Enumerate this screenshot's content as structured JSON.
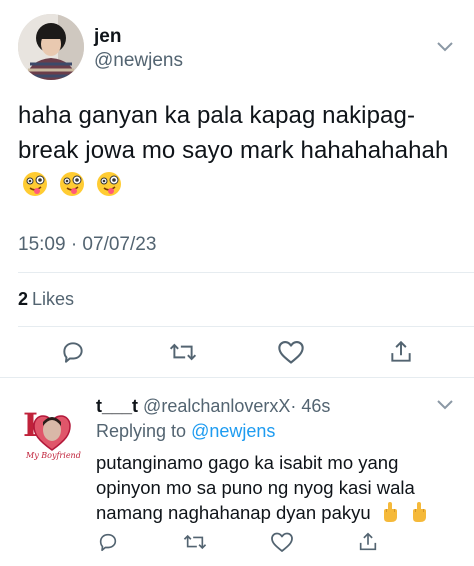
{
  "tweet": {
    "display_name": "jen",
    "handle": "@newjens",
    "text": "haha ganyan ka pala kapag nakipag-break jowa mo sayo mark hahahahahah",
    "emoji": [
      "zany-face",
      "zany-face",
      "zany-face"
    ],
    "timestamp": "15:09 · 07/07/23",
    "likes_count": "2",
    "likes_label": "Likes"
  },
  "reply": {
    "display_name": "t___t",
    "handle": "@realchanloverxX",
    "age": "· 46s",
    "replying_prefix": "Replying to",
    "replying_to": "@newjens",
    "text": "putanginamo gago ka isabit mo yang opinyon mo sa puno ng nyog kasi wala namang naghahanap dyan pakyu",
    "emoji": [
      "middle-finger",
      "middle-finger"
    ]
  },
  "icons": [
    "reply-icon",
    "retweet-icon",
    "like-icon",
    "share-icon",
    "chevron-down-icon"
  ],
  "colors": {
    "text": "#0f1419",
    "secondary": "#536471",
    "link": "#1d9bf0",
    "divider": "#e6ecf0"
  }
}
